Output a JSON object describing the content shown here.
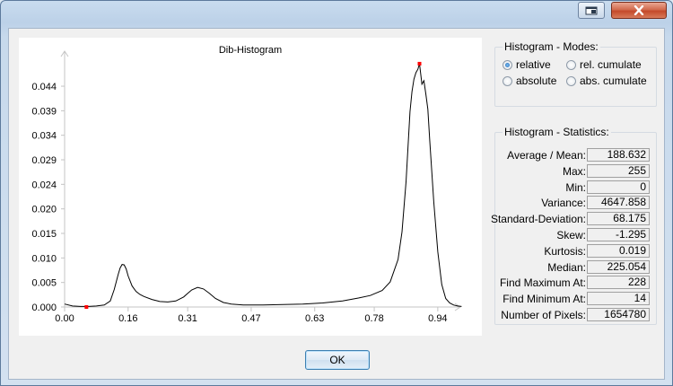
{
  "window": {
    "restore_icon": "restore-icon",
    "close_icon": "close-x-icon",
    "close_color": "#c44a2b"
  },
  "chart_data": {
    "type": "line",
    "title": "Dib-Histogram",
    "xlabel": "",
    "ylabel": "",
    "xlim": [
      0,
      1.0
    ],
    "ylim": [
      0,
      0.049
    ],
    "x_ticks": [
      "0.00",
      "0.16",
      "0.31",
      "0.47",
      "0.63",
      "0.78",
      "0.94"
    ],
    "y_ticks": [
      "0.000",
      "0.005",
      "0.010",
      "0.015",
      "0.020",
      "0.024",
      "0.029",
      "0.034",
      "0.039",
      "0.044"
    ],
    "grid": false,
    "legend": "none",
    "line_color": "#000000",
    "marker_color": "#ff0000",
    "markers": [
      {
        "x": 0.055,
        "y": 0.0
      },
      {
        "x": 0.894,
        "y": 0.0486
      }
    ],
    "series": [
      {
        "x": [
          0.0,
          0.02,
          0.04,
          0.06,
          0.08,
          0.1,
          0.115,
          0.125,
          0.135,
          0.14,
          0.145,
          0.15,
          0.155,
          0.16,
          0.17,
          0.18,
          0.19,
          0.2,
          0.22,
          0.24,
          0.26,
          0.28,
          0.3,
          0.31,
          0.32,
          0.335,
          0.35,
          0.365,
          0.38,
          0.4,
          0.42,
          0.45,
          0.5,
          0.55,
          0.6,
          0.65,
          0.7,
          0.74,
          0.77,
          0.8,
          0.82,
          0.84,
          0.85,
          0.86,
          0.865,
          0.87,
          0.875,
          0.88,
          0.885,
          0.89,
          0.894,
          0.9,
          0.905,
          0.91,
          0.915,
          0.92,
          0.93,
          0.94,
          0.95,
          0.96,
          0.97,
          0.98,
          0.99,
          1.0
        ],
        "y": [
          0.0006,
          0.0002,
          0.0001,
          0.0001,
          0.0002,
          0.0004,
          0.0012,
          0.0035,
          0.0065,
          0.0078,
          0.0085,
          0.0084,
          0.0076,
          0.0062,
          0.0042,
          0.0031,
          0.0025,
          0.0021,
          0.0015,
          0.0011,
          0.001,
          0.0012,
          0.002,
          0.0027,
          0.0034,
          0.0039,
          0.0036,
          0.0027,
          0.0017,
          0.0009,
          0.0006,
          0.0004,
          0.0004,
          0.0005,
          0.0006,
          0.0008,
          0.0012,
          0.0018,
          0.0023,
          0.0033,
          0.005,
          0.0095,
          0.015,
          0.025,
          0.032,
          0.039,
          0.043,
          0.0455,
          0.0468,
          0.0475,
          0.0486,
          0.0445,
          0.0452,
          0.0425,
          0.0395,
          0.033,
          0.021,
          0.011,
          0.0045,
          0.0017,
          0.0008,
          0.0004,
          0.0002,
          0.0001
        ]
      }
    ]
  },
  "modes": {
    "title": "Histogram - Modes:",
    "options": [
      {
        "label": "relative",
        "selected": true
      },
      {
        "label": "rel. cumulate",
        "selected": false
      },
      {
        "label": "absolute",
        "selected": false
      },
      {
        "label": "abs. cumulate",
        "selected": false
      }
    ]
  },
  "stats": {
    "title": "Histogram - Statistics:",
    "rows": [
      {
        "label": "Average / Mean:",
        "value": "188.632"
      },
      {
        "label": "Max:",
        "value": "255"
      },
      {
        "label": "Min:",
        "value": "0"
      },
      {
        "label": "Variance:",
        "value": "4647.858"
      },
      {
        "label": "Standard-Deviation:",
        "value": "68.175"
      },
      {
        "label": "Skew:",
        "value": "-1.295"
      },
      {
        "label": "Kurtosis:",
        "value": "0.019"
      },
      {
        "label": "Median:",
        "value": "225.054"
      },
      {
        "label": "Find Maximum At:",
        "value": "228"
      },
      {
        "label": "Find Minimum At:",
        "value": "14"
      },
      {
        "label": "Number of Pixels:",
        "value": "1654780"
      }
    ]
  },
  "ok_label": "OK"
}
